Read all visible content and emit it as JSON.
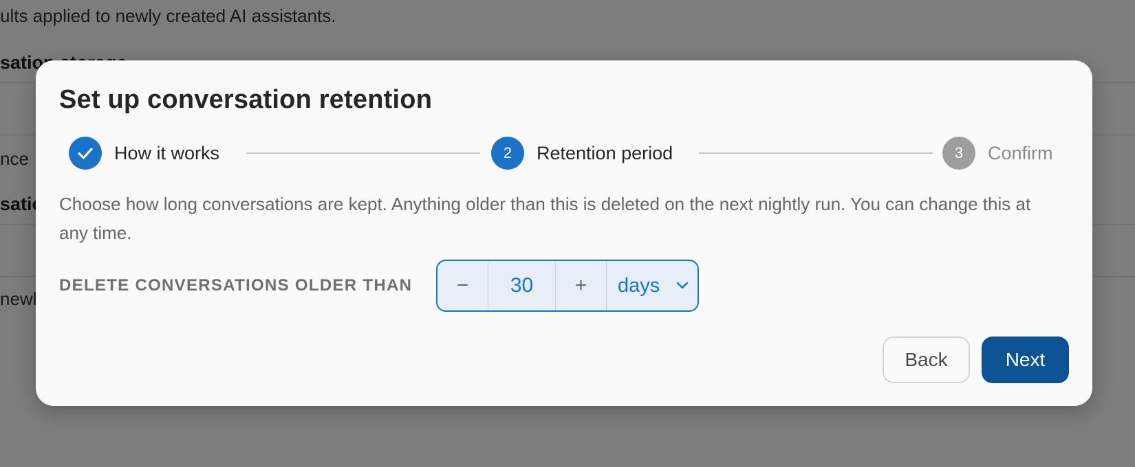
{
  "background": {
    "description_fragment": "ults applied to newly created AI assistants.",
    "heading_fragment_1": "sation storage",
    "text_fragment_1": "nce",
    "heading_fragment_2": "satio",
    "text_fragment_2": "newl"
  },
  "modal": {
    "title": "Set up conversation retention",
    "steps": [
      {
        "number": "",
        "label": "How it works",
        "state": "completed"
      },
      {
        "number": "2",
        "label": "Retention period",
        "state": "active"
      },
      {
        "number": "3",
        "label": "Confirm",
        "state": "upcoming"
      }
    ],
    "description": "Choose how long conversations are kept. Anything older than this is deleted on the next nightly run. You can change this at any time.",
    "retention": {
      "label": "DELETE CONVERSATIONS OLDER THAN",
      "decrement_symbol": "−",
      "value": "30",
      "increment_symbol": "+",
      "unit": "days"
    },
    "buttons": {
      "back": "Back",
      "next": "Next"
    }
  },
  "colors": {
    "accent": "#1a73c8",
    "primary_button": "#0b5394",
    "step_upcoming": "#9e9e9e"
  }
}
